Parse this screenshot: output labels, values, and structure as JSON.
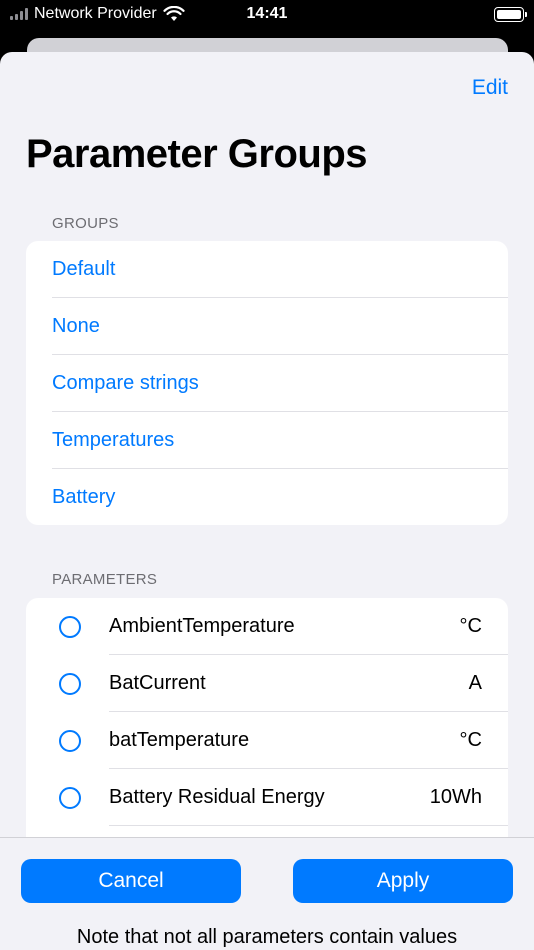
{
  "status_bar": {
    "carrier": "Network Provider",
    "time": "14:41"
  },
  "header": {
    "edit_label": "Edit",
    "title": "Parameter Groups"
  },
  "groups": {
    "header": "GROUPS",
    "items": [
      {
        "label": "Default"
      },
      {
        "label": "None"
      },
      {
        "label": "Compare strings"
      },
      {
        "label": "Temperatures"
      },
      {
        "label": "Battery"
      }
    ]
  },
  "parameters": {
    "header": "PARAMETERS",
    "items": [
      {
        "name": "AmbientTemperature",
        "unit": "°C"
      },
      {
        "name": "BatCurrent",
        "unit": "A"
      },
      {
        "name": "batTemperature",
        "unit": "°C"
      },
      {
        "name": "Battery Residual Energy",
        "unit": "10Wh"
      }
    ]
  },
  "footer": {
    "cancel_label": "Cancel",
    "apply_label": "Apply",
    "note": "Note that not all parameters contain values"
  },
  "colors": {
    "accent": "#007aff",
    "background": "#f2f2f7"
  }
}
